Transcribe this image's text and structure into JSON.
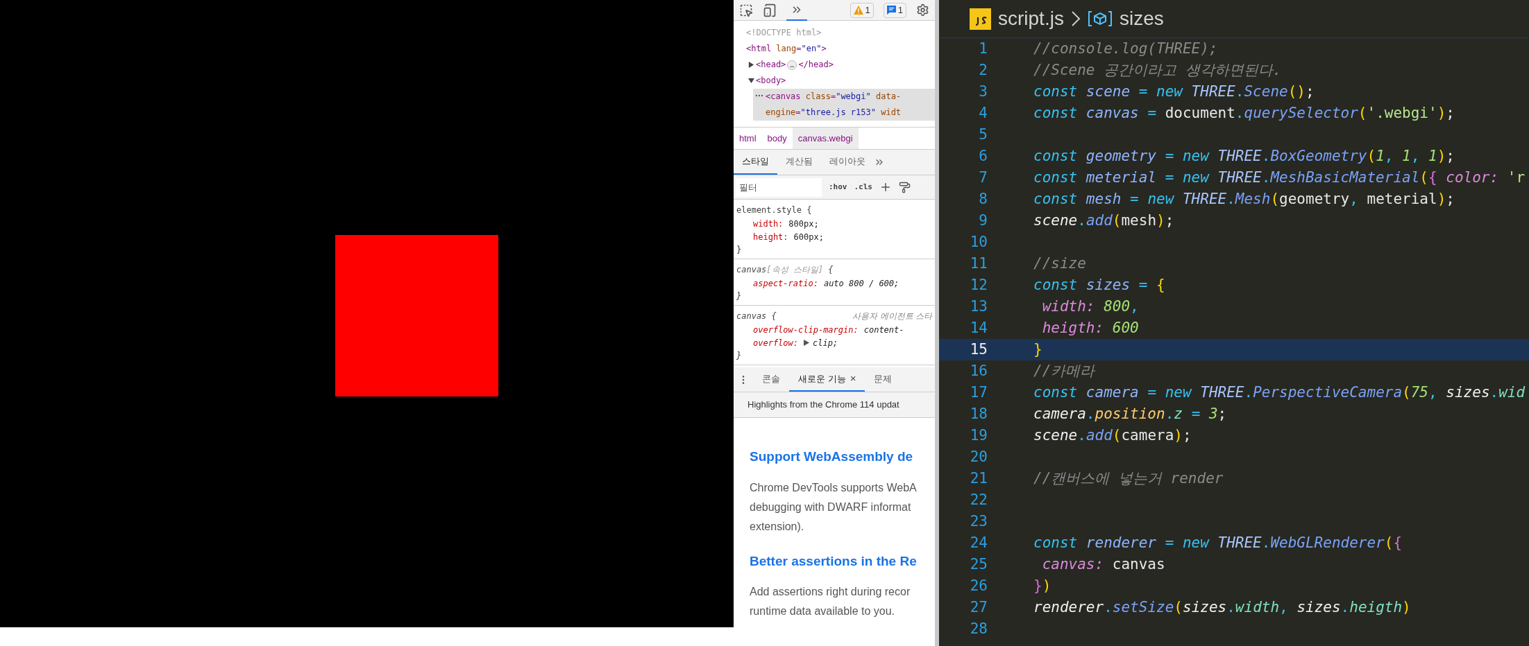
{
  "devtools": {
    "toolbar": {
      "overflow_tab": {
        "selected": true
      },
      "warnings": "1",
      "messages": "1"
    },
    "dom_tree": [
      {
        "kind": "doctype",
        "text": "<!DOCTYPE html>"
      },
      {
        "kind": "element",
        "lines": [
          [
            {
              "kind": "tag",
              "text": "<html "
            },
            {
              "kind": "attr",
              "text": "lang"
            },
            {
              "kind": "tag",
              "text": "="
            },
            {
              "kind": "value",
              "text": "\"en\""
            },
            {
              "kind": "tag",
              "text": ">"
            }
          ]
        ],
        "children": [
          {
            "kind": "element",
            "expanded": false,
            "lines": [
              [
                {
                  "kind": "tag",
                  "text": "<head>"
                },
                {
                  "kind": "ellipsis",
                  "text": "…"
                },
                {
                  "kind": "tag",
                  "text": "</head>"
                }
              ]
            ]
          },
          {
            "kind": "element",
            "expanded": true,
            "lines": [
              [
                {
                  "kind": "tag",
                  "text": "<body>"
                }
              ]
            ],
            "children": [
              {
                "kind": "element",
                "selected": true,
                "lines": [
                  [
                    {
                      "kind": "tag",
                      "text": "<canvas "
                    },
                    {
                      "kind": "attr",
                      "text": "class"
                    },
                    {
                      "kind": "tag",
                      "text": "="
                    },
                    {
                      "kind": "value",
                      "text": "\"webgi\""
                    },
                    {
                      "kind": "attr",
                      "text": " data-"
                    }
                  ],
                  [
                    {
                      "kind": "attr",
                      "text": "engine"
                    },
                    {
                      "kind": "tag",
                      "text": "="
                    },
                    {
                      "kind": "value",
                      "text": "\"three.js r153\""
                    },
                    {
                      "kind": "attr",
                      "text": " widt"
                    }
                  ]
                ]
              }
            ]
          }
        ]
      }
    ],
    "breadcrumbs": [
      {
        "label": "html",
        "selected": false
      },
      {
        "label": "body",
        "selected": false
      },
      {
        "label": "canvas.webgi",
        "selected": true
      }
    ],
    "style_tabs": [
      {
        "label": "스타일",
        "selected": true
      },
      {
        "label": "계산됨",
        "selected": false
      },
      {
        "label": "레이아웃",
        "selected": false
      }
    ],
    "filter": {
      "placeholder": "필터",
      "hov": ":hov",
      "cls": ".cls"
    },
    "rules": [
      {
        "selector": "element.style",
        "bracket": "{",
        "italic": false,
        "declarations": [
          {
            "property": "width:",
            "value": "800px;"
          },
          {
            "property": "height:",
            "value": "600px;"
          }
        ],
        "close": "}"
      },
      {
        "selector": "canvas",
        "note": "[속성 스타일]",
        "bracket": "{",
        "italic": true,
        "declarations": [
          {
            "property": "aspect-ratio:",
            "value": "auto 800 / 600;"
          }
        ],
        "close": "}"
      },
      {
        "selector": "canvas",
        "bracket": "{",
        "source": "사용자 에이전트 스타",
        "italic": true,
        "declarations": [
          {
            "property": "overflow-clip-margin:",
            "value": "content-"
          },
          {
            "property": "overflow:",
            "value": "clip;",
            "kind": "expandable"
          }
        ],
        "close": "}"
      }
    ],
    "drawer_tabs": [
      {
        "label": "콘솔",
        "selected": false
      },
      {
        "label": "새로운 기능",
        "selected": true,
        "close": "×"
      },
      {
        "label": "문제",
        "selected": false
      }
    ],
    "whats_new": {
      "banner": "Highlights from the Chrome 114 updat",
      "sections": [
        {
          "heading": "Support WebAssembly de",
          "body": "Chrome DevTools supports WebA debugging with DWARF informat extension)."
        },
        {
          "heading": "Better assertions in the Re",
          "body": "Add assertions right during recor runtime data available to you."
        }
      ]
    }
  },
  "editor": {
    "file": "script.js",
    "breadcrumb_symbol": "sizes",
    "lines": [
      {
        "number": "1",
        "tokens": [
          {
            "kind": "comment",
            "text": "//console.log(THREE);"
          }
        ]
      },
      {
        "number": "2",
        "tokens": [
          {
            "kind": "comment",
            "text": "//Scene 공간이라고 생각하면된다."
          }
        ]
      },
      {
        "number": "3",
        "tokens": [
          {
            "kind": "kw",
            "text": "const "
          },
          {
            "kind": "decl",
            "text": "scene "
          },
          {
            "kind": "op",
            "text": "= "
          },
          {
            "kind": "kw",
            "text": "new "
          },
          {
            "kind": "cls",
            "text": "THREE"
          },
          {
            "kind": "op",
            "text": "."
          },
          {
            "kind": "fn",
            "text": "Scene"
          },
          {
            "kind": "paren",
            "text": "()"
          },
          {
            "kind": "plain",
            "text": ";"
          }
        ]
      },
      {
        "number": "4",
        "tokens": [
          {
            "kind": "kw",
            "text": "const "
          },
          {
            "kind": "decl",
            "text": "canvas "
          },
          {
            "kind": "op",
            "text": "= "
          },
          {
            "kind": "plain",
            "text": "document"
          },
          {
            "kind": "op",
            "text": "."
          },
          {
            "kind": "fn",
            "text": "querySelector"
          },
          {
            "kind": "paren",
            "text": "("
          },
          {
            "kind": "str",
            "text": "'.webgi'"
          },
          {
            "kind": "paren",
            "text": ")"
          },
          {
            "kind": "plain",
            "text": ";"
          }
        ]
      },
      {
        "number": "5"
      },
      {
        "number": "6",
        "tokens": [
          {
            "kind": "kw",
            "text": "const "
          },
          {
            "kind": "decl",
            "text": "geometry "
          },
          {
            "kind": "op",
            "text": "= "
          },
          {
            "kind": "kw",
            "text": "new "
          },
          {
            "kind": "cls",
            "text": "THREE"
          },
          {
            "kind": "op",
            "text": "."
          },
          {
            "kind": "fn",
            "text": "BoxGeometry"
          },
          {
            "kind": "paren",
            "text": "("
          },
          {
            "kind": "num",
            "text": "1"
          },
          {
            "kind": "op",
            "text": ", "
          },
          {
            "kind": "num",
            "text": "1"
          },
          {
            "kind": "op",
            "text": ", "
          },
          {
            "kind": "num",
            "text": "1"
          },
          {
            "kind": "paren",
            "text": ")"
          },
          {
            "kind": "plain",
            "text": ";"
          }
        ]
      },
      {
        "number": "7",
        "tokens": [
          {
            "kind": "kw",
            "text": "const "
          },
          {
            "kind": "decl",
            "text": "meterial "
          },
          {
            "kind": "op",
            "text": "= "
          },
          {
            "kind": "kw",
            "text": "new "
          },
          {
            "kind": "cls",
            "text": "THREE"
          },
          {
            "kind": "op",
            "text": "."
          },
          {
            "kind": "fn",
            "text": "MeshBasicMaterial"
          },
          {
            "kind": "paren",
            "text": "("
          },
          {
            "kind": "brace",
            "text": "{ "
          },
          {
            "kind": "prop",
            "text": "color: "
          },
          {
            "kind": "str",
            "text": "'r"
          }
        ]
      },
      {
        "number": "8",
        "tokens": [
          {
            "kind": "kw",
            "text": "const "
          },
          {
            "kind": "decl",
            "text": "mesh "
          },
          {
            "kind": "op",
            "text": "= "
          },
          {
            "kind": "kw",
            "text": "new "
          },
          {
            "kind": "cls",
            "text": "THREE"
          },
          {
            "kind": "op",
            "text": "."
          },
          {
            "kind": "fn",
            "text": "Mesh"
          },
          {
            "kind": "paren",
            "text": "("
          },
          {
            "kind": "plain",
            "text": "geometry"
          },
          {
            "kind": "op",
            "text": ", "
          },
          {
            "kind": "plain",
            "text": "meterial"
          },
          {
            "kind": "paren",
            "text": ")"
          },
          {
            "kind": "plain",
            "text": ";"
          }
        ]
      },
      {
        "number": "9",
        "tokens": [
          {
            "kind": "ref",
            "text": "scene"
          },
          {
            "kind": "op",
            "text": "."
          },
          {
            "kind": "fn",
            "text": "add"
          },
          {
            "kind": "paren",
            "text": "("
          },
          {
            "kind": "plain",
            "text": "mesh"
          },
          {
            "kind": "paren",
            "text": ")"
          },
          {
            "kind": "plain",
            "text": ";"
          }
        ]
      },
      {
        "number": "10"
      },
      {
        "number": "11",
        "tokens": [
          {
            "kind": "comment",
            "text": "//size"
          }
        ]
      },
      {
        "number": "12",
        "tokens": [
          {
            "kind": "kw",
            "text": "const "
          },
          {
            "kind": "decl",
            "text": "sizes "
          },
          {
            "kind": "op",
            "text": "= "
          },
          {
            "kind": "paren",
            "text": "{"
          }
        ]
      },
      {
        "number": "13",
        "tokens": [
          {
            "kind": "prop",
            "text": " width: "
          },
          {
            "kind": "num",
            "text": "800"
          },
          {
            "kind": "op",
            "text": ","
          }
        ]
      },
      {
        "number": "14",
        "tokens": [
          {
            "kind": "prop",
            "text": " heigth: "
          },
          {
            "kind": "num",
            "text": "600"
          }
        ]
      },
      {
        "number": "15",
        "selected": true,
        "tokens": [
          {
            "kind": "paren",
            "text": "}"
          }
        ]
      },
      {
        "number": "16",
        "tokens": [
          {
            "kind": "comment",
            "text": "//카메라"
          }
        ]
      },
      {
        "number": "17",
        "tokens": [
          {
            "kind": "kw",
            "text": "const "
          },
          {
            "kind": "decl",
            "text": "camera "
          },
          {
            "kind": "op",
            "text": "= "
          },
          {
            "kind": "kw",
            "text": "new "
          },
          {
            "kind": "cls",
            "text": "THREE"
          },
          {
            "kind": "op",
            "text": "."
          },
          {
            "kind": "fn",
            "text": "PerspectiveCamera"
          },
          {
            "kind": "paren",
            "text": "("
          },
          {
            "kind": "num",
            "text": "75"
          },
          {
            "kind": "op",
            "text": ", "
          },
          {
            "kind": "ref",
            "text": "sizes"
          },
          {
            "kind": "op",
            "text": "."
          },
          {
            "kind": "member",
            "text": "wid"
          }
        ]
      },
      {
        "number": "18",
        "tokens": [
          {
            "kind": "ref",
            "text": "camera"
          },
          {
            "kind": "op",
            "text": "."
          },
          {
            "kind": "field",
            "text": "position"
          },
          {
            "kind": "op",
            "text": "."
          },
          {
            "kind": "member",
            "text": "z "
          },
          {
            "kind": "op",
            "text": "= "
          },
          {
            "kind": "num",
            "text": "3"
          },
          {
            "kind": "plain",
            "text": ";"
          }
        ]
      },
      {
        "number": "19",
        "tokens": [
          {
            "kind": "ref",
            "text": "scene"
          },
          {
            "kind": "op",
            "text": "."
          },
          {
            "kind": "fn",
            "text": "add"
          },
          {
            "kind": "paren",
            "text": "("
          },
          {
            "kind": "plain",
            "text": "camera"
          },
          {
            "kind": "paren",
            "text": ")"
          },
          {
            "kind": "plain",
            "text": ";"
          }
        ]
      },
      {
        "number": "20"
      },
      {
        "number": "21",
        "tokens": [
          {
            "kind": "comment",
            "text": "//캔버스에 넣는거 render"
          }
        ]
      },
      {
        "number": "22"
      },
      {
        "number": "23"
      },
      {
        "number": "24",
        "tokens": [
          {
            "kind": "kw",
            "text": "const "
          },
          {
            "kind": "decl",
            "text": "renderer "
          },
          {
            "kind": "op",
            "text": "= "
          },
          {
            "kind": "kw",
            "text": "new "
          },
          {
            "kind": "cls",
            "text": "THREE"
          },
          {
            "kind": "op",
            "text": "."
          },
          {
            "kind": "fn",
            "text": "WebGLRenderer"
          },
          {
            "kind": "paren",
            "text": "("
          },
          {
            "kind": "brace",
            "text": "{"
          }
        ]
      },
      {
        "number": "25",
        "tokens": [
          {
            "kind": "prop",
            "text": " canvas: "
          },
          {
            "kind": "plain",
            "text": "canvas"
          }
        ]
      },
      {
        "number": "26",
        "tokens": [
          {
            "kind": "brace",
            "text": "}"
          },
          {
            "kind": "paren",
            "text": ")"
          }
        ]
      },
      {
        "number": "27",
        "tokens": [
          {
            "kind": "ref",
            "text": "renderer"
          },
          {
            "kind": "op",
            "text": "."
          },
          {
            "kind": "fn",
            "text": "setSize"
          },
          {
            "kind": "paren",
            "text": "("
          },
          {
            "kind": "ref",
            "text": "sizes"
          },
          {
            "kind": "op",
            "text": "."
          },
          {
            "kind": "member",
            "text": "width"
          },
          {
            "kind": "op",
            "text": ", "
          },
          {
            "kind": "ref",
            "text": "sizes"
          },
          {
            "kind": "op",
            "text": "."
          },
          {
            "kind": "member",
            "text": "heigth"
          },
          {
            "kind": "paren",
            "text": ")"
          }
        ]
      },
      {
        "number": "28"
      }
    ]
  }
}
